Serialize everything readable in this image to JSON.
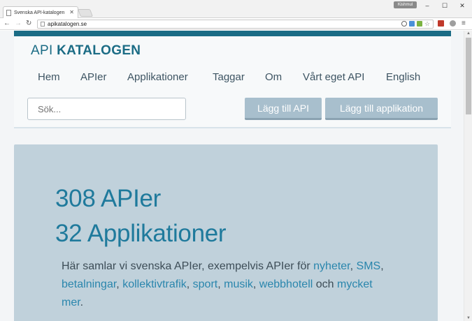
{
  "browser": {
    "tab_title": "Svenska API-katalogen",
    "user_badge": "Kishmul",
    "url": "apikatalogen.se",
    "icons": [
      "page-icon",
      "close-icon",
      "minimize-icon",
      "maximize-icon",
      "window-close-icon",
      "back-icon",
      "forward-icon",
      "reload-icon",
      "lock-icon",
      "zoom-icon",
      "bookmark-star-icon",
      "menu-icon"
    ]
  },
  "site": {
    "logo_light": "API",
    "logo_bold": "KATALOGEN",
    "nav": [
      "Hem",
      "APIer",
      "Applikationer",
      "Taggar",
      "Om",
      "Vårt eget API",
      "English"
    ],
    "search_placeholder": "Sök...",
    "add_api_label": "Lägg till API",
    "add_app_label": "Lägg till applikation"
  },
  "hero": {
    "api_count_line": "308 APIer",
    "app_count_line": "32 Applikationer",
    "intro_prefix": "Här samlar vi svenska APIer, exempelvis APIer för",
    "links": [
      "nyheter",
      "SMS",
      "betalningar",
      "kollektivtrafik",
      "sport",
      "musik",
      "webbhotell"
    ],
    "conjunction": "och",
    "more_link": "mycket mer",
    "end": "."
  },
  "colors": {
    "brand": "#1b6c85",
    "hero_bg": "#c0d1db",
    "button_bg": "#a8bfcd",
    "link": "#2a86ad"
  }
}
